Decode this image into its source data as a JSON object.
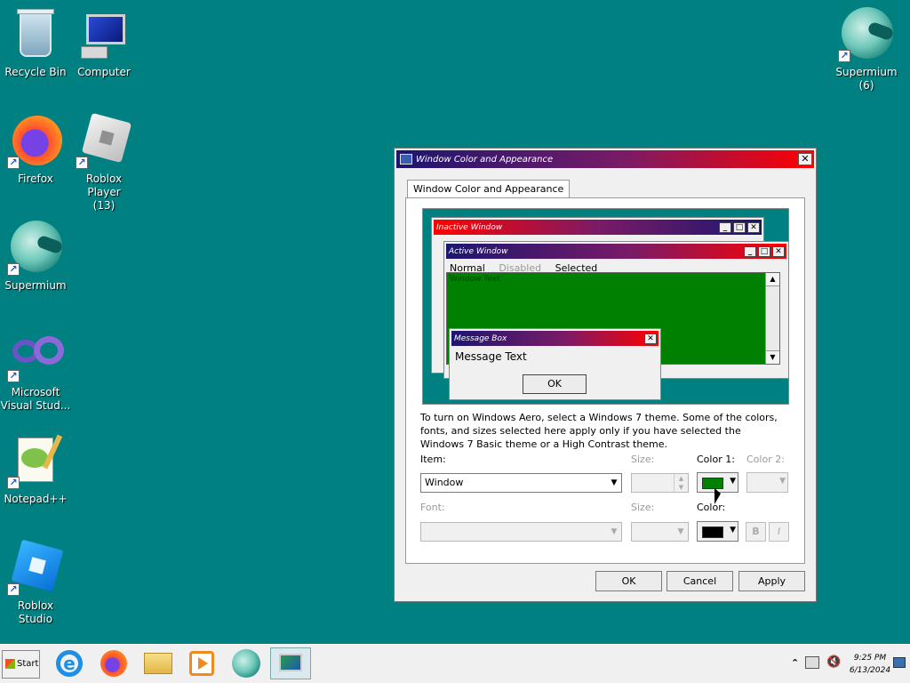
{
  "desktop": {
    "icons": [
      {
        "name": "recycle-bin",
        "label": "Recycle Bin"
      },
      {
        "name": "computer",
        "label": "Computer"
      },
      {
        "name": "firefox",
        "label": "Firefox"
      },
      {
        "name": "roblox-player",
        "label": "Roblox Player\n(13)"
      },
      {
        "name": "supermium",
        "label": "Supermium"
      },
      {
        "name": "visual-studio",
        "label": "Microsoft\nVisual Stud..."
      },
      {
        "name": "notepad-plus-plus",
        "label": "Notepad++"
      },
      {
        "name": "roblox-studio",
        "label": "Roblox Studio"
      },
      {
        "name": "supermium-6",
        "label": "Supermium\n(6)"
      }
    ]
  },
  "dialog": {
    "title": "Window Color and Appearance",
    "tab": "Window Color and Appearance",
    "preview": {
      "inactive_title": "Inactive Window",
      "active_title": "Active Window",
      "menu": {
        "normal": "Normal",
        "disabled": "Disabled",
        "selected": "Selected"
      },
      "window_text": "Window Text",
      "message_title": "Message Box",
      "message_text": "Message Text",
      "ok": "OK"
    },
    "info": "To turn on Windows Aero, select a Windows 7 theme.  Some of the colors, fonts, and sizes selected here apply only if you have selected the Windows 7 Basic theme or a High Contrast theme.",
    "labels": {
      "item": "Item:",
      "size": "Size:",
      "color1": "Color 1:",
      "color2": "Color 2:",
      "font": "Font:",
      "font_size": "Size:",
      "font_color": "Color:"
    },
    "item_value": "Window",
    "colors": {
      "color1": "#008000",
      "font_color": "#000000",
      "accent": "#ff0000",
      "title_dark": "#1b1670"
    },
    "bold_label": "B",
    "italic_label": "I",
    "buttons": {
      "ok": "OK",
      "cancel": "Cancel",
      "apply": "Apply"
    }
  },
  "taskbar": {
    "start": "Start",
    "apps": [
      "internet-explorer",
      "firefox",
      "file-explorer",
      "media-player",
      "supermium",
      "display-settings"
    ],
    "clock_time": "9:25 PM",
    "clock_date": "6/13/2024"
  }
}
